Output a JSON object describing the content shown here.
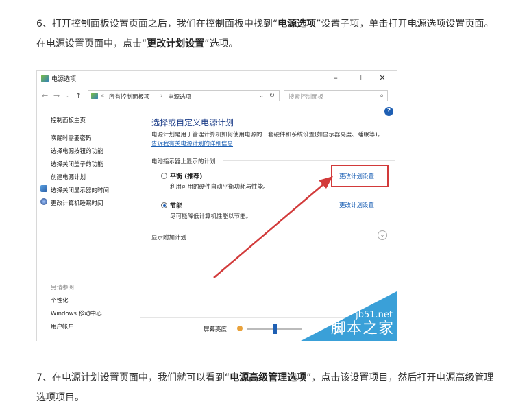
{
  "article": {
    "step6": {
      "t1": "6、打开控制面板设置页面之后，我们在控制面板中找到“",
      "b1": "电源选项",
      "t2": "”设置子项，单击打开电源选项设置页面。在电源设置页面中，点击“",
      "b2": "更改计划设置",
      "t3": "”选项。"
    },
    "step7": {
      "t1": "7、在电源计划设置页面中，我们就可以看到“",
      "b1": "电源高级管理选项",
      "t2": "”，点击该设置项目，然后打开电源高级管理选项项目。"
    }
  },
  "window": {
    "title": "电源选项",
    "btn_min": "–",
    "btn_max": "☐",
    "btn_close": "✕",
    "nav_back": "←",
    "nav_fwd": "→",
    "nav_drop": "⌄",
    "nav_up": "↑",
    "breadcrumb_sep": "«",
    "breadcrumb_1": "所有控制面板项",
    "breadcrumb_arrow": "›",
    "breadcrumb_2": "电源选项",
    "addr_dropdown": "⌄",
    "refresh": "↻",
    "search_placeholder": "搜索控制面板",
    "search_icon": "⌕",
    "help": "?"
  },
  "sidebar": {
    "items": [
      "控制面板主页",
      "唤醒时需要密码",
      "选择电源按钮的功能",
      "选择关闭盖子的功能",
      "创建电源计划",
      "选择关闭显示器的时间",
      "更改计算机睡眠时间"
    ],
    "see_also_title": "另请参阅",
    "see_also": [
      "个性化",
      "Windows 移动中心",
      "用户帐户"
    ]
  },
  "main": {
    "title": "选择或自定义电源计划",
    "desc": "电源计划是用于管理计算机如何使用电源的一套硬件和系统设置(如显示器亮度、睡眠等)。",
    "desc_link": "告诉我有关电源计划的详细信息",
    "section": "电池指示器上显示的计划",
    "plans": [
      {
        "name": "平衡 (推荐)",
        "desc": "利用可用的硬件自动平衡功耗与性能。",
        "link": "更改计划设置",
        "selected": false
      },
      {
        "name": "节能",
        "desc": "尽可能降低计算机性能以节能。",
        "link": "更改计划设置",
        "selected": true
      }
    ],
    "more_plans": "显示附加计划",
    "more_btn": "⌄",
    "brightness_label": "屏幕亮度:",
    "brightness_level": 0.5
  },
  "watermark": {
    "url": "jb51.net",
    "name": "脚本之家"
  },
  "colors": {
    "highlight": "#d23a3a",
    "link": "#1a5fb4",
    "watermark": "#3aa0d8"
  }
}
